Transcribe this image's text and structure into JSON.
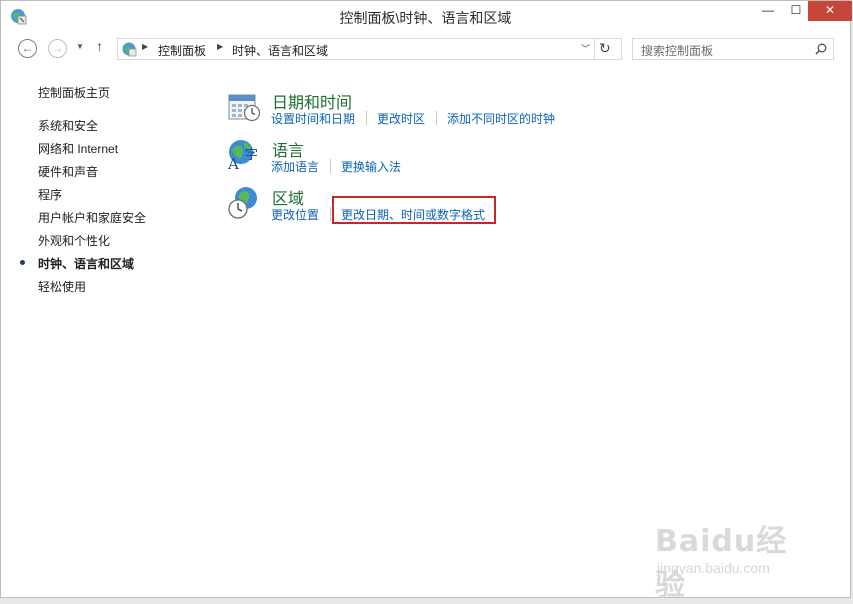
{
  "window": {
    "title": "控制面板\\时钟、语言和区域",
    "minimize": "—",
    "maximize": "☐",
    "close": "✕"
  },
  "nav": {
    "back": "←",
    "forward": "→",
    "recent": "▼",
    "up": "↑",
    "breadcrumbs": [
      "控制面板",
      "时钟、语言和区域"
    ],
    "dropdown": "﹀",
    "refresh": "↻"
  },
  "search": {
    "placeholder": "搜索控制面板"
  },
  "sidebar": {
    "items": [
      "控制面板主页",
      "系统和安全",
      "网络和 Internet",
      "硬件和声音",
      "程序",
      "用户帐户和家庭安全",
      "外观和个性化",
      "时钟、语言和区域",
      "轻松使用"
    ],
    "current_index": 7
  },
  "categories": [
    {
      "title": "日期和时间",
      "icon": "calendar-clock-icon",
      "links": [
        "设置时间和日期",
        "更改时区",
        "添加不同时区的时钟"
      ]
    },
    {
      "title": "语言",
      "icon": "language-globe-icon",
      "links": [
        "添加语言",
        "更换输入法"
      ]
    },
    {
      "title": "区域",
      "icon": "region-globe-clock-icon",
      "links": [
        "更改位置",
        "更改日期、时间或数字格式"
      ]
    }
  ],
  "highlighted_link": "更改日期、时间或数字格式",
  "watermark": {
    "logo": "Baidu经验",
    "url": "jingyan.baidu.com"
  },
  "colors": {
    "link": "#0b63b8",
    "category_title": "#1e6d2f",
    "close_button": "#c7463b",
    "highlight_border": "#c62828"
  }
}
